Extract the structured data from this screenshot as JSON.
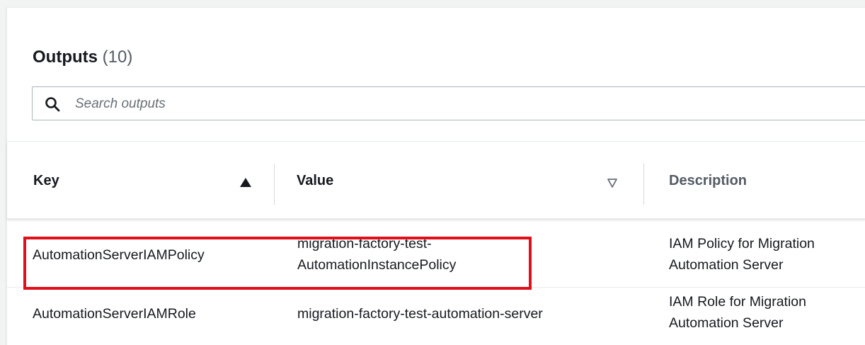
{
  "header": {
    "title": "Outputs",
    "count": "(10)"
  },
  "search": {
    "placeholder": "Search outputs",
    "icon": "search-icon"
  },
  "table": {
    "columns": [
      {
        "label": "Key",
        "sort": "ascending"
      },
      {
        "label": "Value",
        "sort": "sortable"
      },
      {
        "label": "Description",
        "sort": "none"
      }
    ],
    "rows": [
      {
        "key": "AutomationServerIAMPolicy",
        "value_lines": [
          "migration-factory-test-",
          "AutomationInstancePolicy"
        ],
        "description_lines": [
          "IAM Policy for Migration",
          "Automation Server"
        ],
        "highlighted": true
      },
      {
        "key": "AutomationServerIAMRole",
        "value_lines": [
          "migration-factory-test-automation-server"
        ],
        "description_lines": [
          "IAM Role for Migration",
          "Automation Server"
        ],
        "highlighted": false
      }
    ]
  },
  "colors": {
    "highlight_border": "#e0101b",
    "text_primary": "#16191f",
    "text_secondary": "#545b64",
    "page_background": "#f2f3f3"
  }
}
